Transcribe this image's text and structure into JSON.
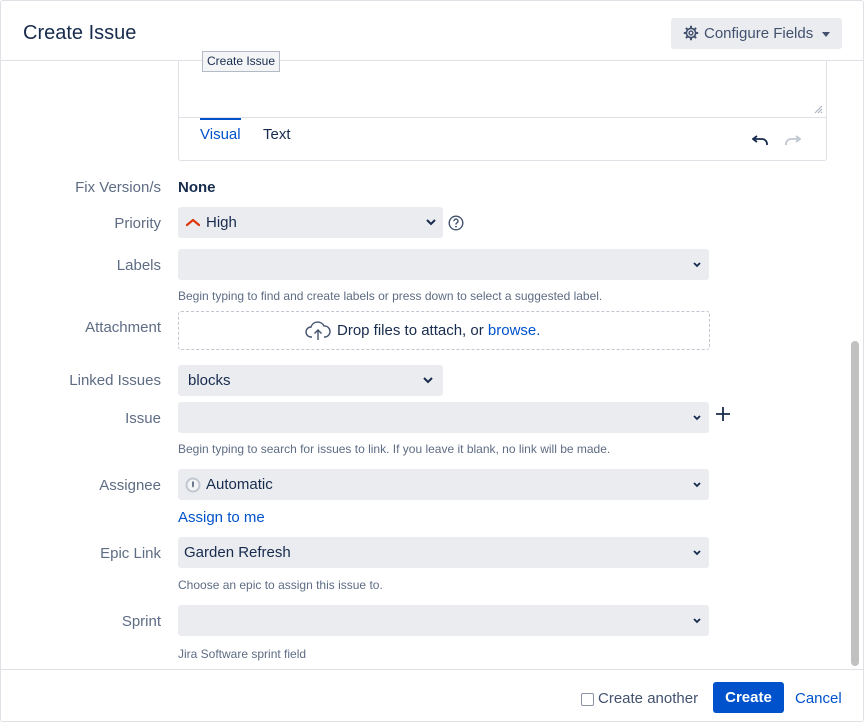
{
  "header": {
    "title": "Create Issue",
    "configure_label": "Configure Fields",
    "tooltip": "Create Issue"
  },
  "editor": {
    "tab_visual": "Visual",
    "tab_text": "Text"
  },
  "fields": {
    "fix_version": {
      "label": "Fix Version/s",
      "value": "None"
    },
    "priority": {
      "label": "Priority",
      "value": "High",
      "color": "#de350b"
    },
    "labels": {
      "label": "Labels",
      "value": "",
      "help": "Begin typing to find and create labels or press down to select a suggested label."
    },
    "attachment": {
      "label": "Attachment",
      "drop_text": "Drop files to attach, or ",
      "browse": "browse."
    },
    "linked_issues": {
      "label": "Linked Issues",
      "value": "blocks"
    },
    "issue": {
      "label": "Issue",
      "value": "",
      "help": "Begin typing to search for issues to link. If you leave it blank, no link will be made."
    },
    "assignee": {
      "label": "Assignee",
      "value": "Automatic",
      "assign_link": "Assign to me"
    },
    "epic_link": {
      "label": "Epic Link",
      "value": "Garden Refresh",
      "help": "Choose an epic to assign this issue to."
    },
    "sprint": {
      "label": "Sprint",
      "value": "",
      "help": "Jira Software sprint field"
    }
  },
  "footer": {
    "create_another": "Create another",
    "create_another_checked": false,
    "create": "Create",
    "cancel": "Cancel"
  },
  "colors": {
    "accent": "#0052cc",
    "field_bg": "#ebecf0",
    "label": "#5e6c84"
  },
  "icons": [
    "gear-icon",
    "chevron-down-icon",
    "help-icon",
    "cloud-upload-icon",
    "plus-icon",
    "undo-icon",
    "redo-icon",
    "priority-high-icon",
    "avatar-icon",
    "resize-handle-icon"
  ]
}
